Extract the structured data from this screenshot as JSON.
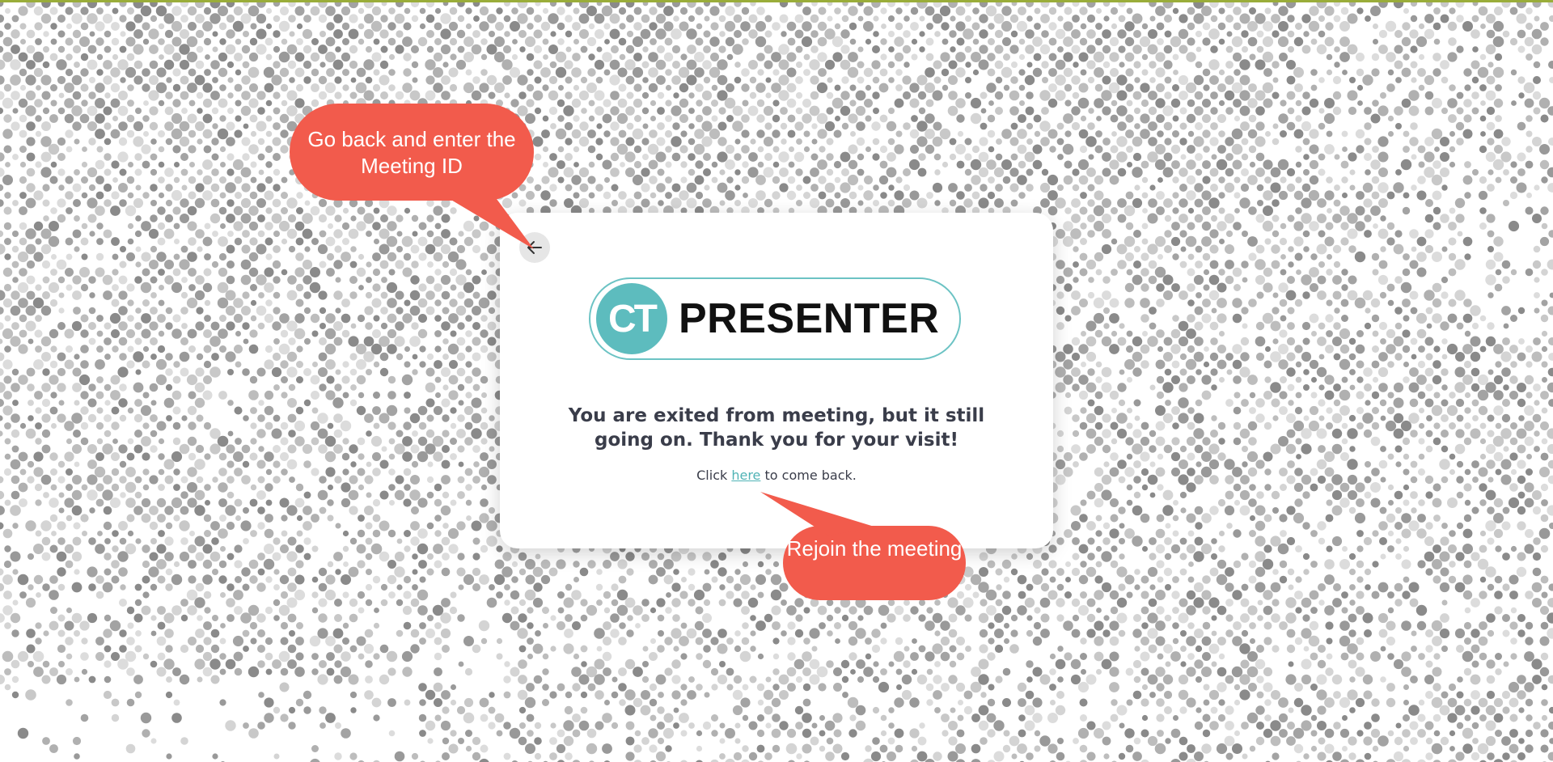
{
  "app": {
    "accent_color": "#5dbcbe",
    "link_color": "#4fb3b5",
    "callout_color": "#f25b4c",
    "top_line_color": "#9aad3a"
  },
  "card": {
    "back_button_icon": "arrow-left-icon",
    "logo": {
      "mark": "CT",
      "wordmark": "PRESENTER"
    },
    "message": "You are exited from meeting, but it still going on. Thank you for your visit!",
    "comeback": {
      "prefix": "Click",
      "link_text": "here",
      "suffix": "to come back."
    }
  },
  "callouts": {
    "back": "Go back and enter the Meeting ID",
    "rejoin": "Rejoin the meeting"
  }
}
